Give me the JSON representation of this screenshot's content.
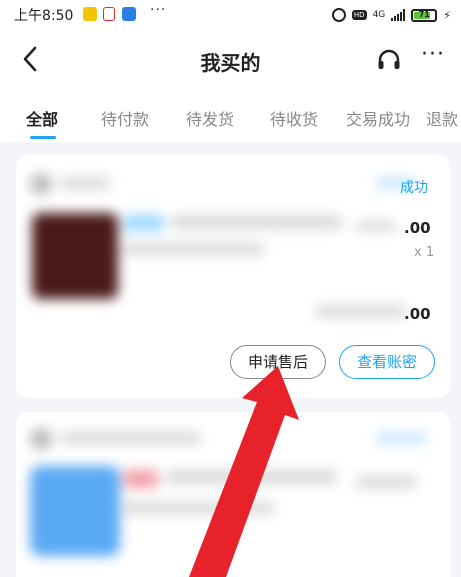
{
  "status_bar": {
    "time": "上午8:50",
    "dots": "···",
    "hd": "HD",
    "network": "4G",
    "battery": "71"
  },
  "header": {
    "title": "我买的",
    "back_icon": "chevron-left-icon",
    "service_icon": "headset-icon",
    "more": "···"
  },
  "tabs": [
    {
      "label": "全部"
    },
    {
      "label": "待付款"
    },
    {
      "label": "待发货"
    },
    {
      "label": "待收货"
    },
    {
      "label": "交易成功"
    },
    {
      "label": "退款"
    }
  ],
  "order1": {
    "status": "成功",
    "price": ".00",
    "qty": "x 1",
    "total": ".00",
    "buttons": {
      "after_sales": "申请售后",
      "view_account": "查看账密"
    }
  },
  "colors": {
    "accent": "#1ea3f7",
    "arrow": "#e8222b"
  }
}
